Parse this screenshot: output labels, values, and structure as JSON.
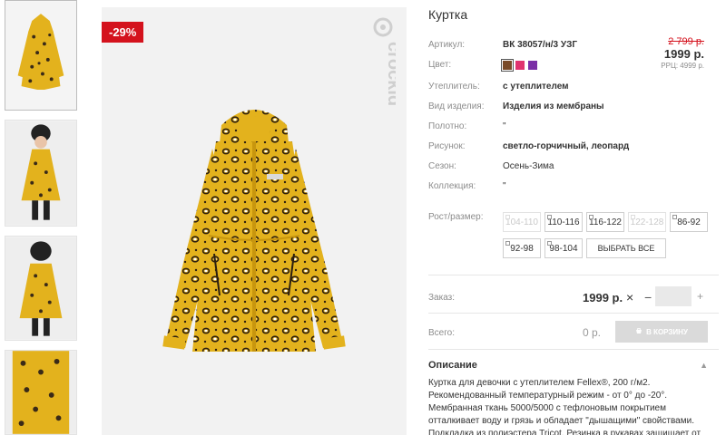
{
  "product": {
    "title": "Куртка",
    "discount_badge": "-29%",
    "brand_logo": "crockid",
    "old_price": "2 799 р.",
    "new_price": "1999 р.",
    "rrc": "РРЦ: 4999 р."
  },
  "attributes": [
    {
      "label": "Артикул:",
      "value": "ВК 38057/н/3 УЗГ",
      "bold": true
    },
    {
      "label": "Цвет:",
      "value": "",
      "bold": false
    },
    {
      "label": "Утеплитель:",
      "value": "с утеплителем",
      "bold": true
    },
    {
      "label": "Вид изделия:",
      "value": "Изделия из мембраны",
      "bold": true
    },
    {
      "label": "Полотно:",
      "value": "\"",
      "bold": false
    },
    {
      "label": "Рисунок:",
      "value": "светло-горчичный, леопард",
      "bold": true
    },
    {
      "label": "Сезон:",
      "value": "Осень-Зима",
      "bold": false
    },
    {
      "label": "Коллекция:",
      "value": "\"",
      "bold": false
    }
  ],
  "colors": [
    {
      "name": "brown",
      "hex": "#7a4a28",
      "active": true
    },
    {
      "name": "pink",
      "hex": "#e0336f",
      "active": false
    },
    {
      "name": "purple",
      "hex": "#7b2fa6",
      "active": false
    }
  ],
  "sizes": {
    "label": "Рост/размер:",
    "items": [
      {
        "label": "104-110",
        "disabled": true
      },
      {
        "label": "110-116",
        "disabled": false
      },
      {
        "label": "116-122",
        "disabled": false
      },
      {
        "label": "122-128",
        "disabled": true
      },
      {
        "label": "86-92",
        "disabled": false
      },
      {
        "label": "92-98",
        "disabled": false
      },
      {
        "label": "98-104",
        "disabled": false
      }
    ],
    "select_all": "ВЫБРАТЬ ВСЕ"
  },
  "order": {
    "label": "Заказ:",
    "price": "1999 р.",
    "remove": "×",
    "minus": "−",
    "plus": "+",
    "qty": ""
  },
  "total": {
    "label": "Всего:",
    "value": "0 р.",
    "cart_button": "В КОРЗИНУ"
  },
  "description": {
    "title": "Описание",
    "text": "Куртка для девочки с утеплителем Fellex®, 200 г/м2. Рекомендованный температурный режим - от 0° до -20°. Мембранная ткань 5000/5000 с тефлоновым покрытием отталкивает воду и грязь и обладает \"дышащими\" свойствами. Подкладка из полиэстера Tricot. Резинка в рукавах защищает от ветра и попадания осадков."
  },
  "theme": {
    "accent_red": "#d4121d",
    "mustard": "#e3b21d",
    "cart_disabled": "#dadada"
  }
}
